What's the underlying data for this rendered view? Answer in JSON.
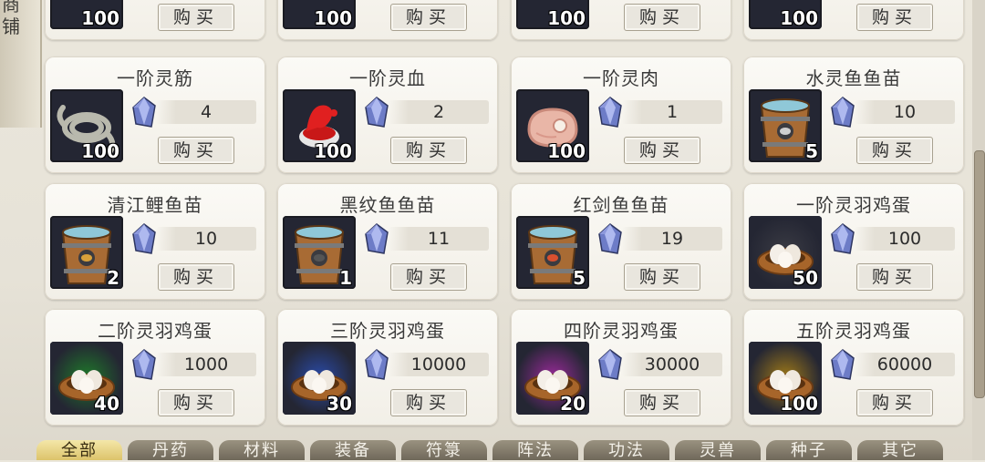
{
  "left_banner": {
    "glyphs": [
      "商",
      "铺"
    ]
  },
  "buy_label": "购买",
  "partial_row": [
    {
      "count": "100"
    },
    {
      "count": "100"
    },
    {
      "count": "100"
    },
    {
      "count": "100"
    }
  ],
  "items": [
    {
      "name": "一阶灵筋",
      "price": "4",
      "count": "100",
      "icon": "rope-icon"
    },
    {
      "name": "一阶灵血",
      "price": "2",
      "count": "100",
      "icon": "blood-icon"
    },
    {
      "name": "一阶灵肉",
      "price": "1",
      "count": "100",
      "icon": "meat-icon"
    },
    {
      "name": "水灵鱼鱼苗",
      "price": "10",
      "count": "5",
      "icon": "bucket-icon"
    },
    {
      "name": "清江鲤鱼苗",
      "price": "10",
      "count": "2",
      "icon": "bucket-icon"
    },
    {
      "name": "黑纹鱼鱼苗",
      "price": "11",
      "count": "1",
      "icon": "bucket-icon"
    },
    {
      "name": "红剑鱼鱼苗",
      "price": "19",
      "count": "5",
      "icon": "bucket-icon"
    },
    {
      "name": "一阶灵羽鸡蛋",
      "price": "100",
      "count": "50",
      "icon": "egg-nest-icon"
    },
    {
      "name": "二阶灵羽鸡蛋",
      "price": "1000",
      "count": "40",
      "icon": "egg-nest-icon"
    },
    {
      "name": "三阶灵羽鸡蛋",
      "price": "10000",
      "count": "30",
      "icon": "egg-nest-icon"
    },
    {
      "name": "四阶灵羽鸡蛋",
      "price": "30000",
      "count": "20",
      "icon": "egg-nest-icon"
    },
    {
      "name": "五阶灵羽鸡蛋",
      "price": "60000",
      "count": "100",
      "icon": "egg-nest-icon"
    }
  ],
  "colors": {
    "bucket_fish": [
      "#cfcfcf",
      "#d9a13a",
      "#555",
      "#d9502f"
    ],
    "egg_glow": [
      "#3a3b44",
      "#1f7a2a",
      "#2a4aa8",
      "#9a2a9a",
      "#a07a18"
    ]
  },
  "tabs": [
    "全部",
    "丹药",
    "材料",
    "装备",
    "符箓",
    "阵法",
    "功法",
    "灵兽",
    "种子",
    "其它"
  ],
  "active_tab": "全部"
}
